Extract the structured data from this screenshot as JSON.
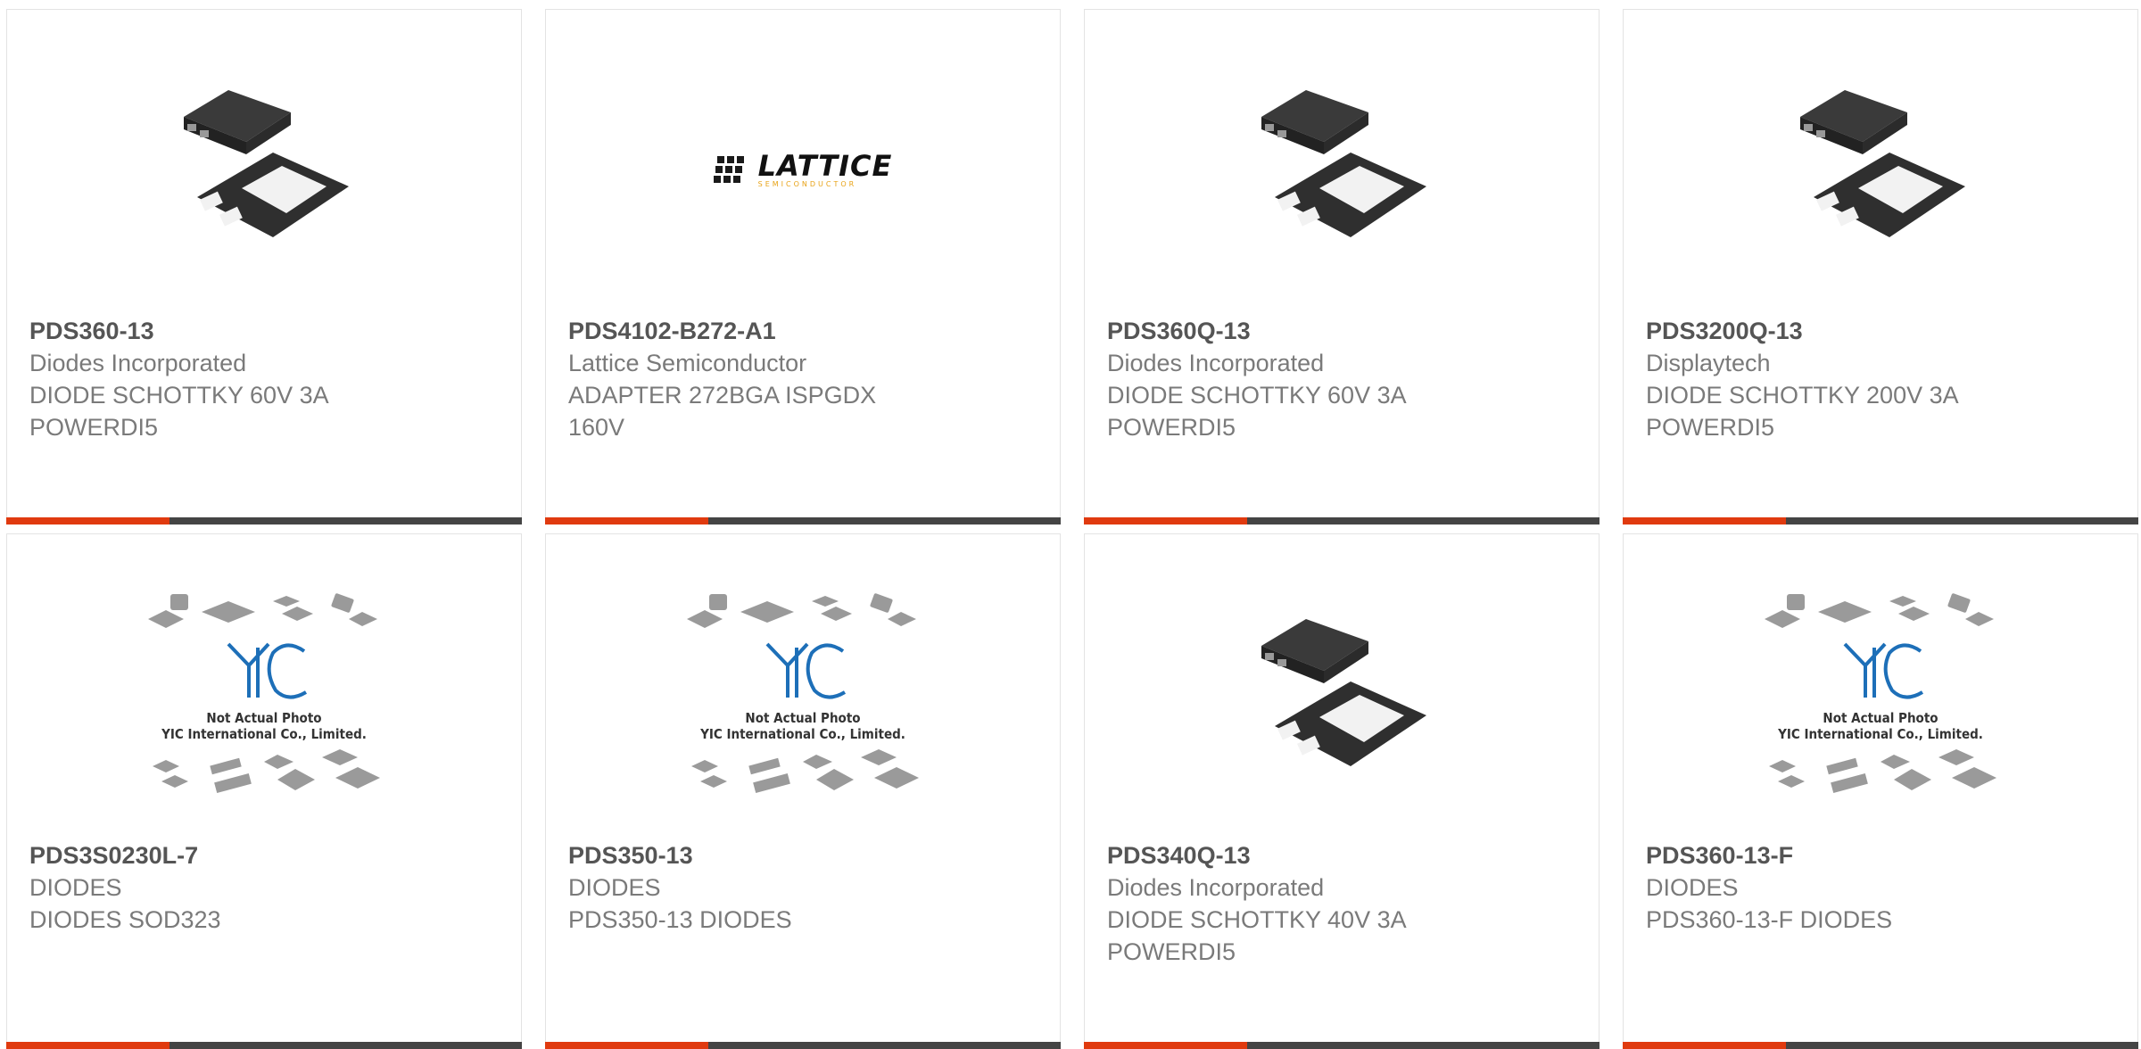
{
  "products": [
    {
      "part": "PDS360-13",
      "maker": "Diodes Incorporated",
      "desc1": "DIODE SCHOTTKY 60V 3A",
      "desc2": "POWERDI5",
      "image": "powerdi5-package"
    },
    {
      "part": "PDS4102-B272-A1",
      "maker": "Lattice Semiconductor",
      "desc1": "ADAPTER 272BGA ISPGDX",
      "desc2": "160V",
      "image": "lattice-logo",
      "logo_text": "LATTICE",
      "logo_sub": "SEMICONDUCTOR"
    },
    {
      "part": "PDS360Q-13",
      "maker": "Diodes Incorporated",
      "desc1": "DIODE SCHOTTKY 60V 3A",
      "desc2": "POWERDI5",
      "image": "powerdi5-package"
    },
    {
      "part": "PDS3200Q-13",
      "maker": "Displaytech",
      "desc1": "DIODE SCHOTTKY 200V 3A",
      "desc2": "POWERDI5",
      "image": "powerdi5-package"
    },
    {
      "part": "PDS3S0230L-7",
      "maker": "DIODES",
      "desc1": "DIODES SOD323",
      "desc2": "",
      "image": "yic-placeholder"
    },
    {
      "part": "PDS350-13",
      "maker": "DIODES",
      "desc1": "PDS350-13 DIODES",
      "desc2": "",
      "image": "yic-placeholder"
    },
    {
      "part": "PDS340Q-13",
      "maker": "Diodes Incorporated",
      "desc1": "DIODE SCHOTTKY 40V 3A",
      "desc2": "POWERDI5",
      "image": "powerdi5-package"
    },
    {
      "part": "PDS360-13-F",
      "maker": "DIODES",
      "desc1": "PDS360-13-F DIODES",
      "desc2": "",
      "image": "yic-placeholder"
    }
  ],
  "placeholder": {
    "line1": "Not Actual Photo",
    "line2": "YIC International Co., Limited.",
    "logo": "YIC"
  },
  "colors": {
    "accent": "#e03a0f",
    "bar": "#444444",
    "package": "#2f2f2f",
    "text": "#7a7a7a",
    "yic_blue": "#1d6fb8"
  }
}
